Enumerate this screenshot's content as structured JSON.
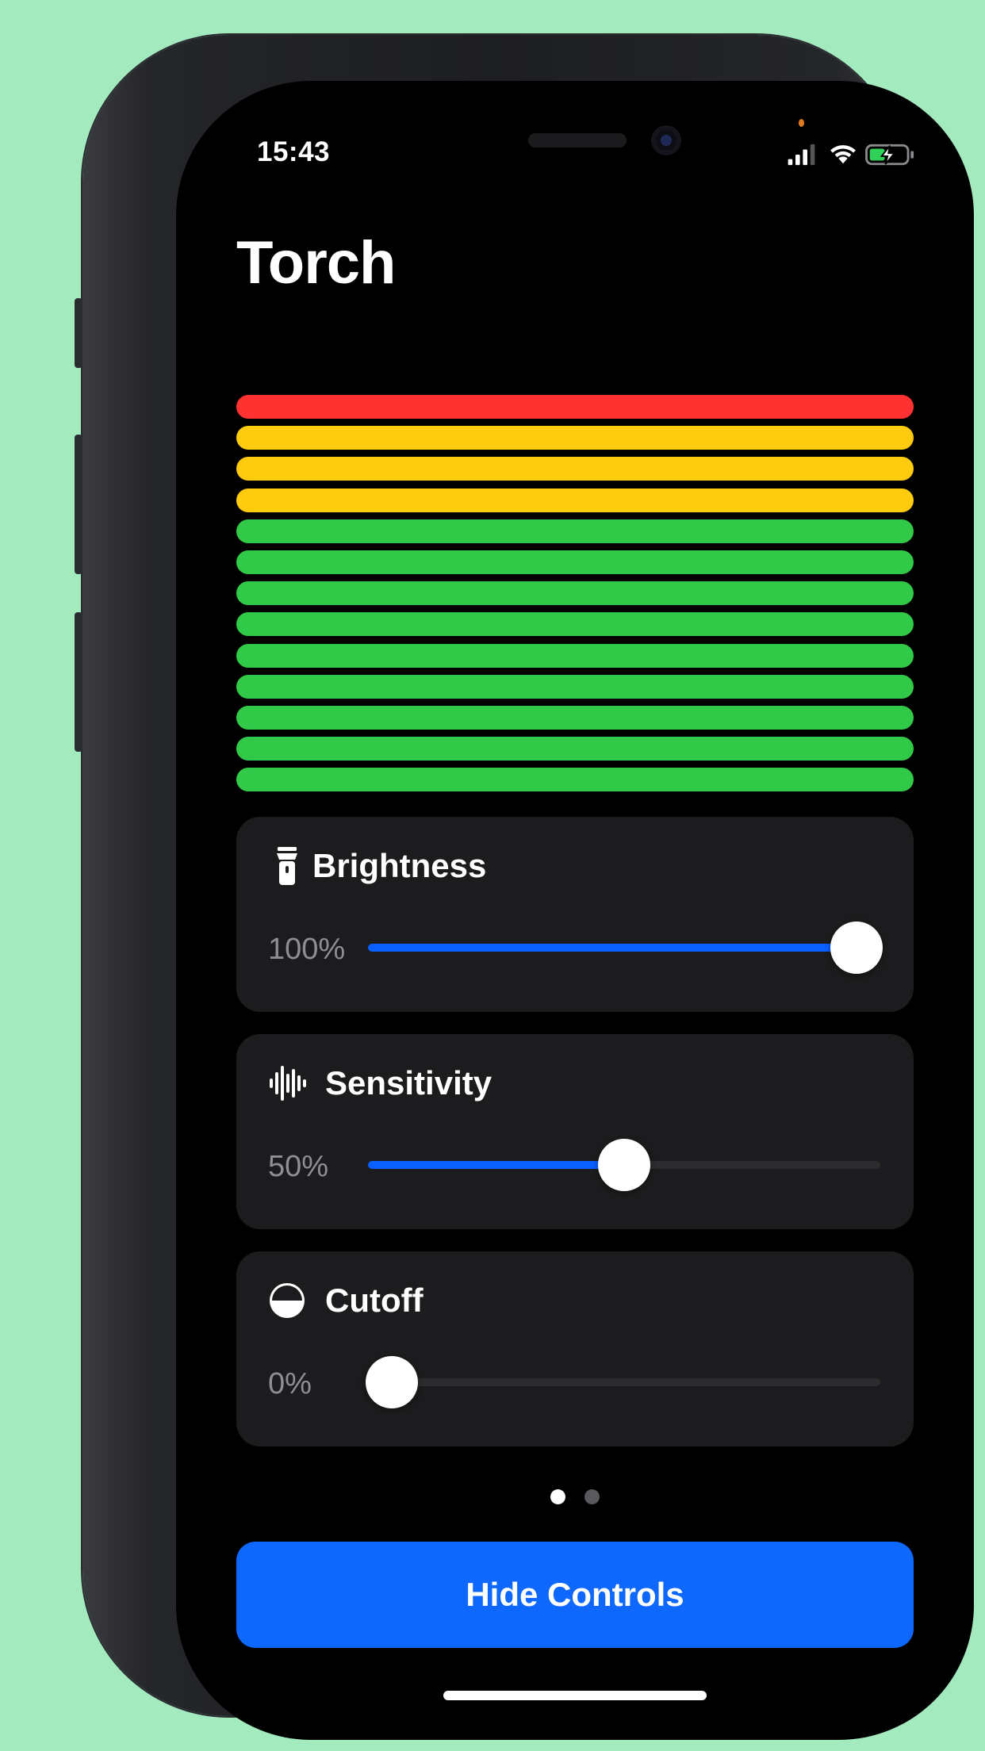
{
  "status_bar": {
    "time": "15:43"
  },
  "app": {
    "title": "Torch"
  },
  "meter": {
    "bars": [
      {
        "color": "#ff3131"
      },
      {
        "color": "#ffcb0f"
      },
      {
        "color": "#ffcb0f"
      },
      {
        "color": "#ffcb0f"
      },
      {
        "color": "#31c948"
      },
      {
        "color": "#31c948"
      },
      {
        "color": "#31c948"
      },
      {
        "color": "#31c948"
      },
      {
        "color": "#31c948"
      },
      {
        "color": "#31c948"
      },
      {
        "color": "#31c948"
      },
      {
        "color": "#31c948"
      },
      {
        "color": "#31c948"
      }
    ]
  },
  "controls": {
    "brightness": {
      "label": "Brightness",
      "value_text": "100%",
      "value": 1.0,
      "icon": "flashlight-icon"
    },
    "sensitivity": {
      "label": "Sensitivity",
      "value_text": "50%",
      "value": 0.5,
      "icon": "waveform-icon"
    },
    "cutoff": {
      "label": "Cutoff",
      "value_text": "0%",
      "value": 0.0,
      "icon": "half-circle-icon"
    }
  },
  "page_indicator": {
    "count": 2,
    "current": 0,
    "active_color": "#ffffff",
    "inactive_color": "#5a5a5e"
  },
  "hide_button": {
    "label": "Hide Controls"
  },
  "colors": {
    "accent": "#0e68fe",
    "card_bg": "#1c1c1e",
    "background": "#a3ebbf"
  }
}
